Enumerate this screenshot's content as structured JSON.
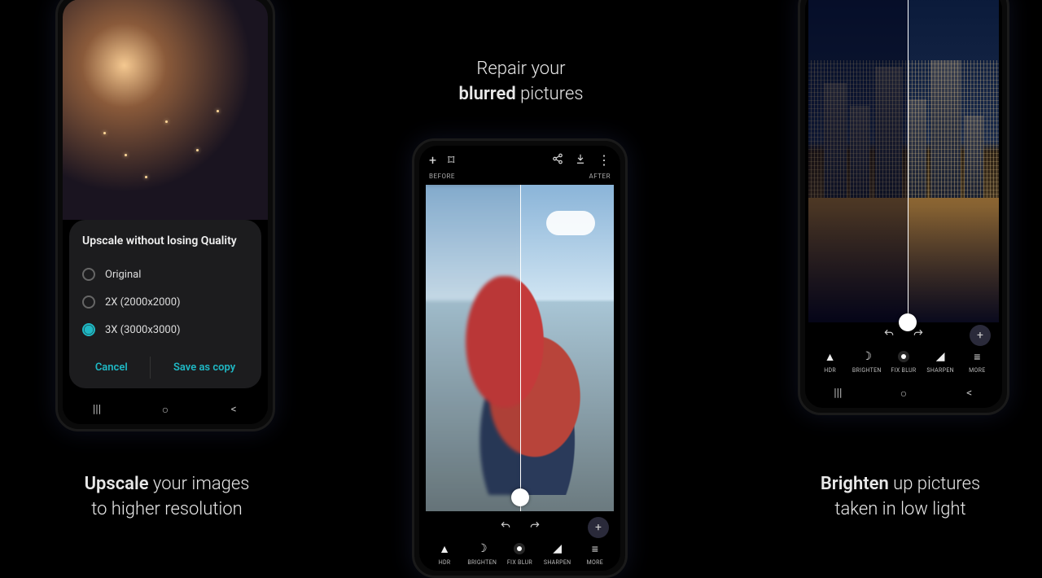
{
  "captions": {
    "upscale_before": "Upscale",
    "upscale_after": " your images\nto higher resolution",
    "repair_before": "Repair your\n",
    "repair_strong": "blurred",
    "repair_after": " pictures",
    "brighten_strong": "Brighten",
    "brighten_after": " up pictures\ntaken in low light"
  },
  "phone1": {
    "dialog_title": "Upscale without losing Quality",
    "options": [
      {
        "label": "Original",
        "checked": false
      },
      {
        "label": "2X (2000x2000)",
        "checked": false
      },
      {
        "label": "3X (3000x3000)",
        "checked": true
      }
    ],
    "cancel": "Cancel",
    "save": "Save as copy"
  },
  "editor": {
    "before": "BEFORE",
    "after": "AFTER",
    "tools": {
      "hdr": "HDR",
      "brighten": "BRIGHTEN",
      "fixblur": "FIX BLUR",
      "sharpen": "SHARPEN",
      "more": "MORE"
    }
  }
}
